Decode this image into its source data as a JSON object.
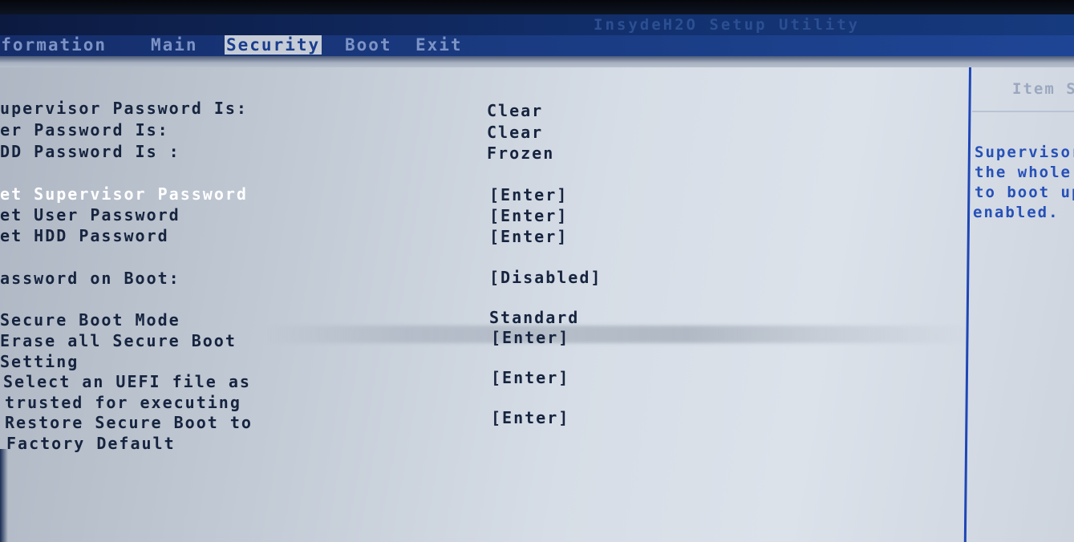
{
  "app": {
    "title": "InsydeH2O Setup Utility"
  },
  "menu": {
    "tabs": [
      {
        "label": "Information",
        "active": false
      },
      {
        "label": "Main",
        "active": false
      },
      {
        "label": "Security",
        "active": true
      },
      {
        "label": "Boot",
        "active": false
      },
      {
        "label": "Exit",
        "active": false
      }
    ]
  },
  "security": {
    "status_rows": [
      {
        "label": "Supervisor Password Is:",
        "value": "Clear"
      },
      {
        "label": "User Password Is:",
        "value": "Clear"
      },
      {
        "label": "HDD Password Is :",
        "value": "Frozen"
      }
    ],
    "set_rows": [
      {
        "label": "Set Supervisor Password",
        "value": "[Enter]",
        "selected": true
      },
      {
        "label": "Set User Password",
        "value": "[Enter]"
      },
      {
        "label": "Set HDD Password",
        "value": "[Enter]"
      }
    ],
    "password_on_boot": {
      "label": "Password on Boot:",
      "value": "[Disabled]"
    },
    "secure_boot_mode": {
      "label": "Secure Boot Mode",
      "value": "Standard"
    },
    "erase_secure_boot": {
      "label_line1": "Erase all Secure Boot",
      "label_line2": "Setting",
      "value": "[Enter]"
    },
    "select_uefi": {
      "label_line1": "Select an UEFI file as",
      "label_line2": "trusted for executing",
      "value": "[Enter]"
    },
    "restore_secure_boot": {
      "label_line1": "Restore Secure Boot to",
      "label_line2": "Factory Default",
      "value": "[Enter]"
    }
  },
  "help_panel": {
    "title": "Item Specific Help",
    "lines": [
      "Supervisor Password controls access to",
      "the whole setup utility. It can be used",
      "to boot up when Password on boot is",
      "enabled."
    ]
  },
  "colors": {
    "background": "#d2d9e3",
    "title_bar": "#12306e",
    "menu_bar": "#1a3b82",
    "active_tab_bg": "#c5ccd8",
    "help_text": "#2650b8",
    "divider": "#1e46b6",
    "text": "#16243f",
    "selected_text": "#ffffff"
  }
}
